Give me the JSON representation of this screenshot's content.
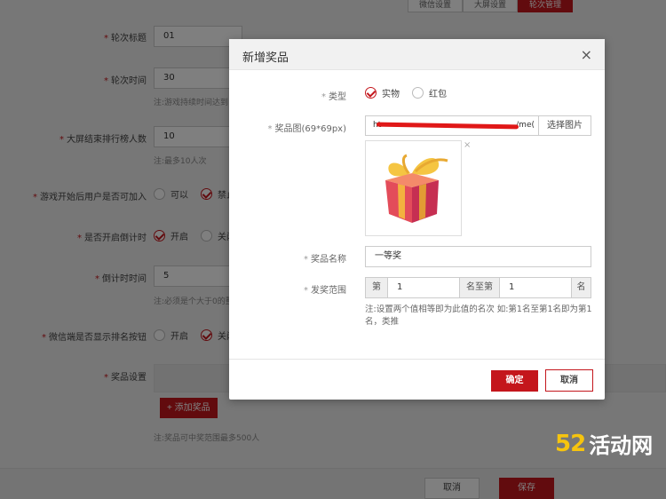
{
  "background": {
    "tabs": [
      "微信设置",
      "大屏设置",
      "轮次管理"
    ],
    "fields": [
      {
        "label": "轮次标题",
        "value": "01"
      },
      {
        "label": "轮次时间",
        "value": "30",
        "note": "注:游戏持续时间达到"
      },
      {
        "label": "大屏结束排行榜人数",
        "value": "10",
        "note": "注:最多10人次"
      },
      {
        "label": "游戏开始后用户是否可加入",
        "options": [
          "可以",
          "禁止"
        ]
      },
      {
        "label": "是否开启倒计时",
        "options": [
          "开启",
          "关闭"
        ]
      },
      {
        "label": "倒计时时间",
        "value": "5",
        "note": "注:必须是个大于0的整"
      },
      {
        "label": "微信端是否显示排名按钮",
        "options": [
          "开启",
          "关闭"
        ]
      },
      {
        "label": "奖品设置"
      }
    ],
    "add_prize_label": "+ 添加奖品",
    "prize_note": "注:奖品可中奖范围最多500人",
    "cancel_label": "取消",
    "save_label": "保存"
  },
  "modal": {
    "title": "新增奖品",
    "close": "×",
    "type_label": "类型",
    "type_options": [
      "实物",
      "红包"
    ],
    "image_label": "奖品图(69*69px)",
    "image_url": "ht",
    "image_url_tail": "/me(",
    "choose_image_label": "选择图片",
    "remove_icon": "×",
    "name_label": "奖品名称",
    "name_value": "一等奖",
    "range_label": "发奖范围",
    "range_prefix": "第",
    "range_from": "1",
    "range_mid": "名至第",
    "range_to": "1",
    "range_suffix": "名",
    "range_note": "注:设置两个值相等即为此值的名次 如:第1名至第1名即为第1名，类推",
    "ok_label": "确定",
    "cancel_label": "取消"
  },
  "watermark": {
    "num": "52",
    "text": "活动网"
  },
  "colors": {
    "accent": "#c4161c",
    "watermark_num": "#f6c40e"
  }
}
